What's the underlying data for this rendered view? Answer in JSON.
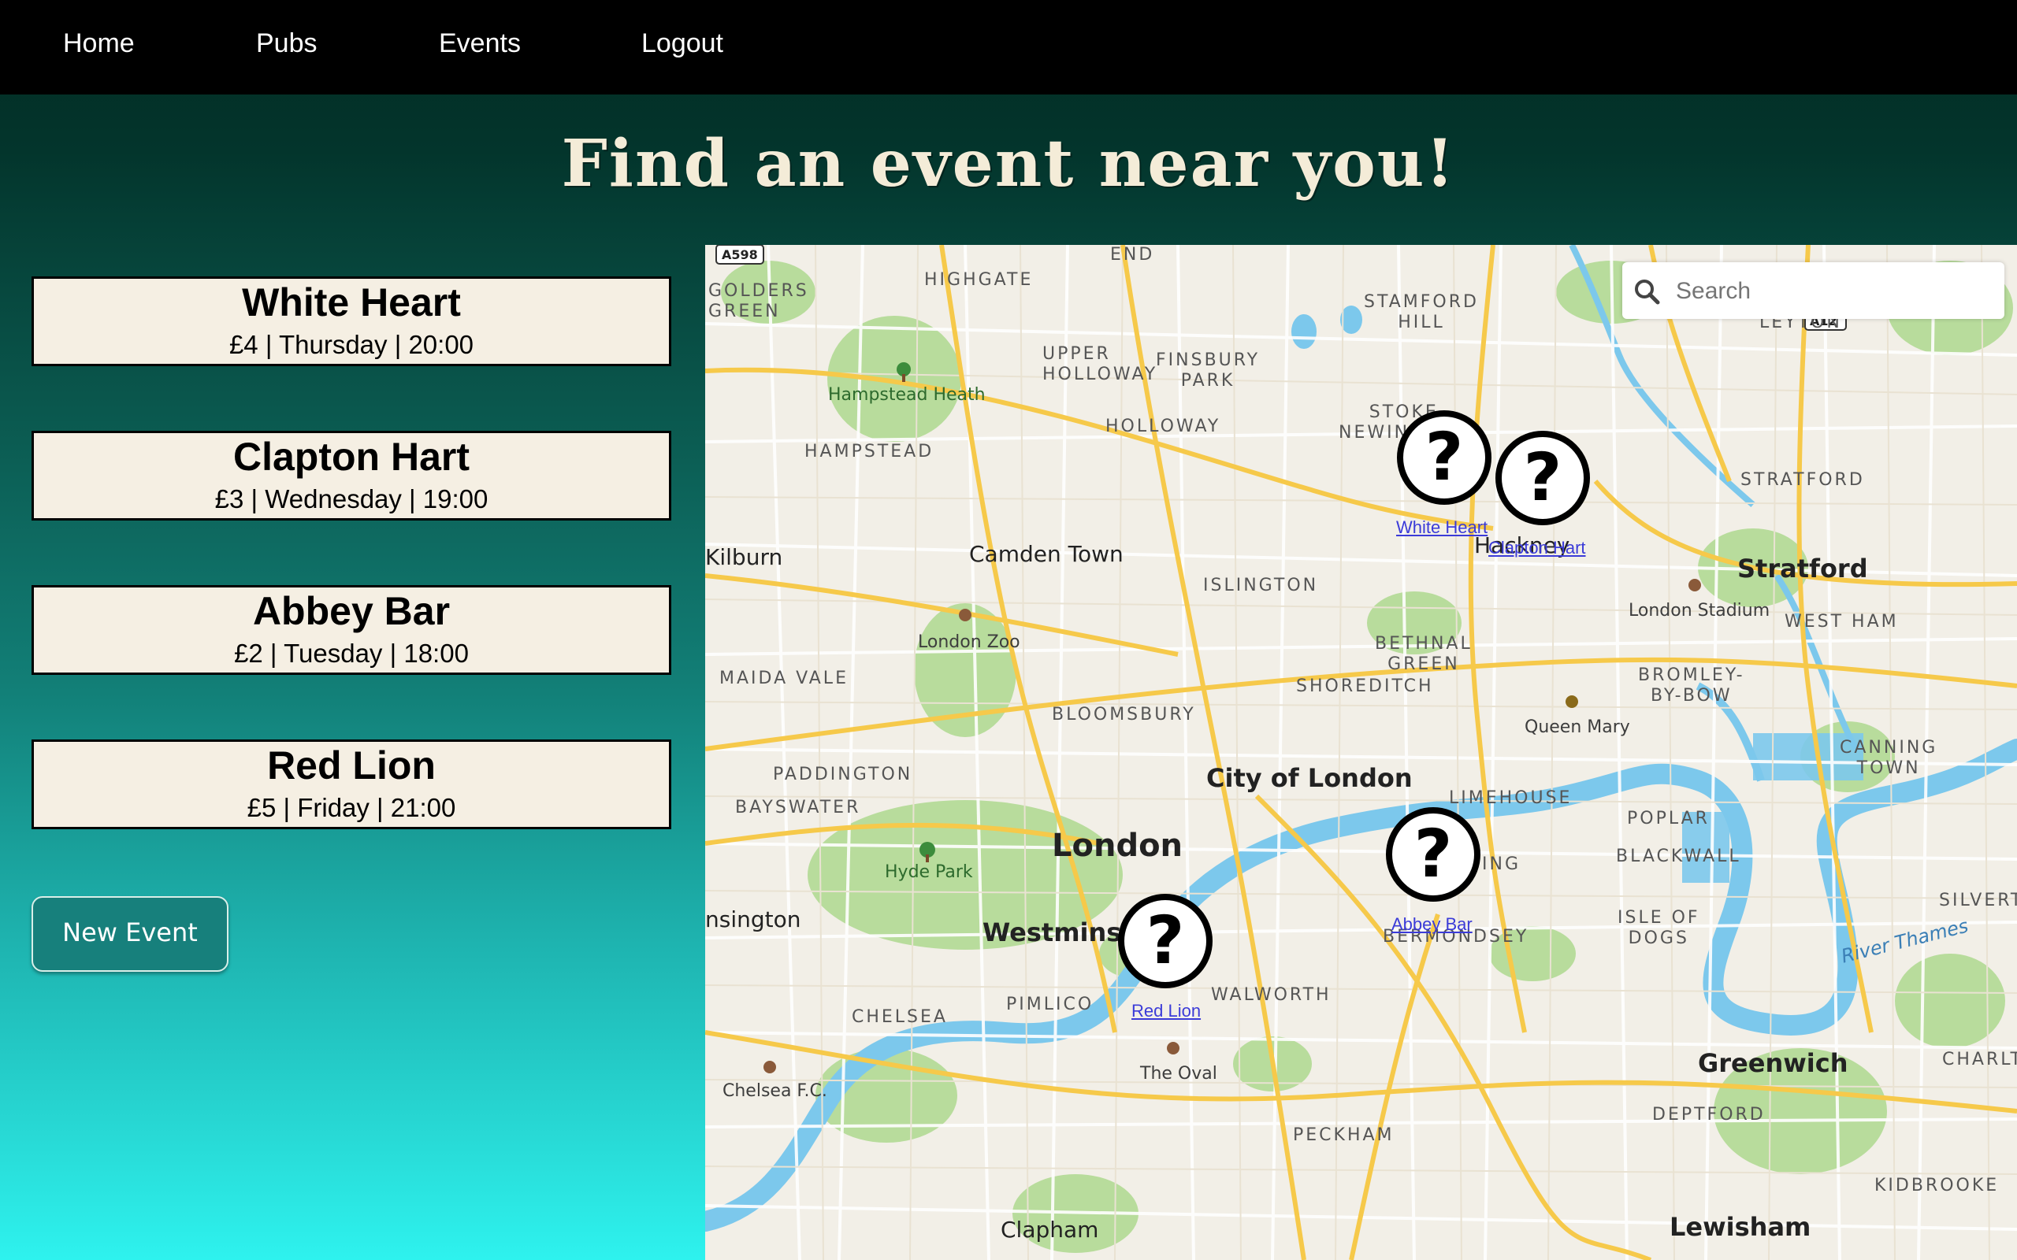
{
  "nav": {
    "items": [
      "Home",
      "Pubs",
      "Events",
      "Logout"
    ]
  },
  "page": {
    "title": "Find an event near you!",
    "new_event_label": "New Event"
  },
  "events": [
    {
      "name": "White Heart",
      "details": "£4 | Thursday | 20:00"
    },
    {
      "name": "Clapton Hart",
      "details": "£3 | Wednesday | 19:00"
    },
    {
      "name": "Abbey Bar",
      "details": "£2 | Tuesday | 18:00"
    },
    {
      "name": "Red Lion",
      "details": "£5 | Friday | 21:00"
    }
  ],
  "map": {
    "search": {
      "placeholder": "Search"
    },
    "markers": [
      {
        "label": "White Heart",
        "icon": "question-mark-icon"
      },
      {
        "label": "Clapton Hart",
        "icon": "question-mark-icon"
      },
      {
        "label": "Abbey Bar",
        "icon": "question-mark-icon"
      },
      {
        "label": "Red Lion",
        "icon": "question-mark-icon"
      }
    ],
    "places": {
      "london": "London",
      "city_of_london": "City of London",
      "westminster": "Westminster",
      "camden_town": "Camden Town",
      "hackney": "Hackney",
      "stratford": "Stratford",
      "greenwich": "Greenwich",
      "clapham": "Clapham",
      "lewisham": "Lewisham",
      "kilburn": "Kilburn",
      "kensington": "nsington",
      "hampstead_heath": "Hampstead Heath",
      "hyde_park": "Hyde Park",
      "london_zoo": "London Zoo",
      "the_oval": "The Oval",
      "chelsea_fc": "Chelsea F.C.",
      "queen_mary": "Queen Mary",
      "london_stadium": "London Stadium",
      "river_thames": "River Thames",
      "highgate": "HIGHGATE",
      "golders_green": "GOLDERS\nGREEN",
      "upper_holloway": "UPPER\nHOLLOWAY",
      "finsbury_park": "FINSBURY\nPARK",
      "stamford_hill": "STAMFORD\nHILL",
      "stoke_newington": "STOKE\nNEWINGTON",
      "holloway": "HOLLOWAY",
      "hampstead": "HAMPSTEAD",
      "islington": "ISLINGTON",
      "bethnal_green": "BETHNAL\nGREEN",
      "shoreditch": "SHOREDITCH",
      "maida_vale": "MAIDA VALE",
      "bloomsbury": "BLOOMSBURY",
      "paddington": "PADDINGTON",
      "bayswater": "BAYSWATER",
      "limehouse": "LIMEHOUSE",
      "poplar": "POPLAR",
      "blackwall": "BLACKWALL",
      "bromley_by_bow": "BROMLEY-\nBY-BOW",
      "canning_town": "CANNING\nTOWN",
      "west_ham": "WEST HAM",
      "leyton": "LEYTON",
      "isle_of_dogs": "ISLE OF\nDOGS",
      "bermondsey": "BERMONDSEY",
      "walworth": "WALWORTH",
      "pimlico": "PIMLICO",
      "chelsea": "CHELSEA",
      "peckham": "PECKHAM",
      "deptford": "DEPTFORD",
      "kidbrooke": "KIDBROOKE",
      "charlton": "CHARLTO",
      "silvertown": "SILVERTO",
      "end": "END",
      "a598": "A598",
      "a12": "A12",
      "wapping": "ING"
    }
  },
  "colors": {
    "nav_bg": "#000000",
    "card_bg": "#f5efe3",
    "button_bg": "#17807c",
    "map_road_major": "#f6c94a",
    "map_water": "#7cc8ec",
    "map_park": "#b8dc9c"
  }
}
